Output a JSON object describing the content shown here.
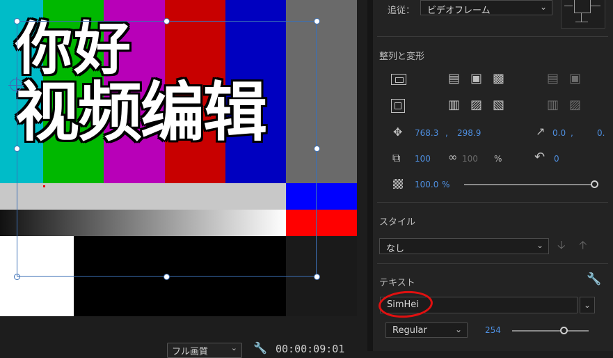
{
  "preview": {
    "overlay_line1": "你好",
    "overlay_line2": "视频编辑",
    "colors": {
      "cyan": "#00bcc8",
      "green": "#00b800",
      "magenta": "#b800b8",
      "red": "#c80000",
      "blue": "#0000c0",
      "gray": "#6a6a6a",
      "light_gray": "#c8c8c8",
      "bright_blue": "#0000ff",
      "bright_red": "#ff0000",
      "white": "#ffffff",
      "black": "#000000"
    }
  },
  "bottom_bar": {
    "quality_label": "フル画質",
    "timecode": "00:00:09:01"
  },
  "panel": {
    "follow_label": "追従：",
    "follow_value": "ビデオフレーム",
    "align_section_title": "整列と変形",
    "position_x": "768.3",
    "position_sep": ",",
    "position_y": "298.9",
    "anchor_x": "0.0",
    "anchor_sep": ",",
    "anchor_y": "0.",
    "scale_value": "100",
    "scale_linked_value": "100",
    "scale_unit": "%",
    "rotation_value": "0",
    "opacity_value": "100.0",
    "opacity_unit": "%",
    "style_section_title": "スタイル",
    "style_value": "なし",
    "text_section_title": "テキスト",
    "font_name": "SimHei",
    "font_style": "Regular",
    "font_size": "254",
    "accent_color": "#4e8fe0",
    "annotation_color": "#e01010"
  }
}
